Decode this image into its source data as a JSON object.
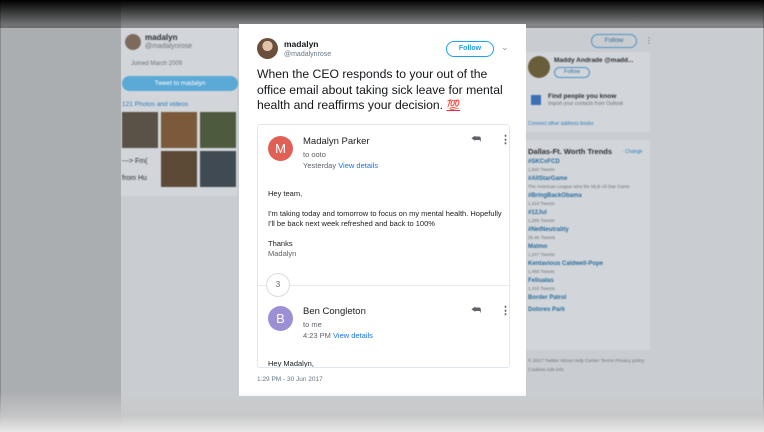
{
  "background": {
    "profile": {
      "name": "madalyn",
      "handle": "@madalynrose",
      "joined": "Joined March 2009",
      "tweet_button": "Tweet to madalyn",
      "photos_link": "121 Photos and videos",
      "sidebar_text_1": "---> Fm(",
      "sidebar_text_2": "from Hu"
    },
    "top_follow": "Follow",
    "who_to_follow": {
      "name": "Maddy Andrade @madd...",
      "follow": "Follow",
      "find_title": "Find people you know",
      "find_sub": "Import your contacts from Outlook",
      "connect": "Connect other address books"
    },
    "trends": {
      "title": "Dallas-Ft. Worth Trends",
      "change": "· Change",
      "items": [
        {
          "name": "#SKCvFCD",
          "sub": "1,840 Tweets"
        },
        {
          "name": "#AllStarGame",
          "sub": "The American League wins the MLB All-Star Game"
        },
        {
          "name": "#BringBackObama",
          "sub": "1,424 Tweets"
        },
        {
          "name": "#12Jul",
          "sub": "1,285 Tweets"
        },
        {
          "name": "#NetNeutrality",
          "sub": "25.4K Tweets"
        },
        {
          "name": "Matmo",
          "sub": "1,247 Tweets"
        },
        {
          "name": "Kentavious Caldwell-Pope",
          "sub": "1,468 Tweets"
        },
        {
          "name": "Feliualas",
          "sub": "1,316 Tweets"
        },
        {
          "name": "Border Patrol",
          "sub": ""
        },
        {
          "name": "Dolores Park",
          "sub": ""
        }
      ],
      "footer": "© 2017 Twitter  About  Help Center  Terms  Privacy policy  Cookies  Ads info"
    }
  },
  "tweet": {
    "name": "madalyn",
    "handle": "@madalynrose",
    "follow_label": "Follow",
    "text": "When the CEO responds to your out of the office email about taking sick leave for mental health and reaffirms your decision.",
    "emoji": "💯",
    "timestamp": "1:29 PM - 30 Jun 2017",
    "email_screenshot": {
      "message1": {
        "avatar_letter": "M",
        "sender": "Madalyn Parker",
        "to": "to ooto",
        "date": "Yesterday",
        "details_link": "View details",
        "greeting": "Hey team,",
        "body": "I'm taking today and tomorrow to focus on my mental health. Hopefully I'll be back next week refreshed and back to 100%",
        "sign_thanks": "Thanks",
        "sign_name": "Madalyn"
      },
      "collapsed_count": "3",
      "message2": {
        "avatar_letter": "B",
        "sender": "Ben Congleton",
        "to": "to me",
        "date": "4:23 PM",
        "details_link": "View details",
        "greeting": "Hey Madalyn,"
      }
    }
  },
  "colors": {
    "twitter_blue": "#1da1f2",
    "avatar_m": "#e06055",
    "avatar_b": "#9c8fd6"
  }
}
